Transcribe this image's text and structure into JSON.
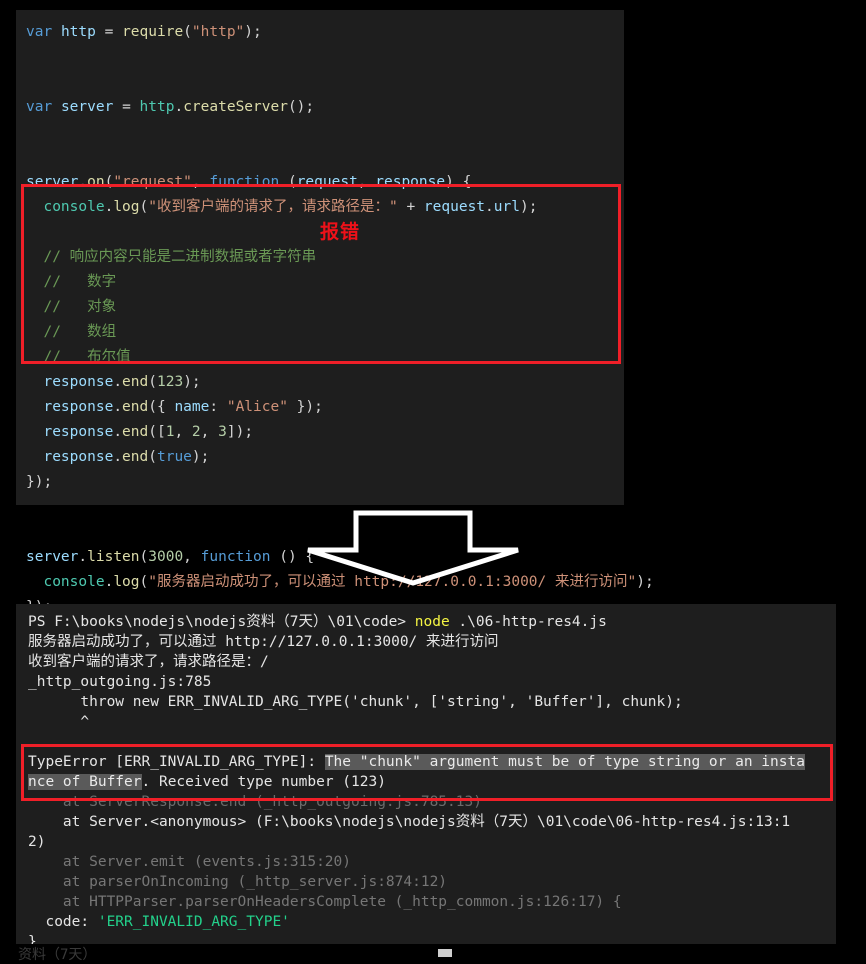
{
  "editor": {
    "name": "code-editor-panel",
    "background": "#1e1e1e",
    "lines": [
      {
        "id": "l1",
        "text": "var http = require(\"http\");"
      },
      {
        "id": "l2",
        "text": ""
      },
      {
        "id": "l3",
        "text": ""
      },
      {
        "id": "l4",
        "text": "var server = http.createServer();"
      },
      {
        "id": "l5",
        "text": ""
      },
      {
        "id": "l6",
        "text": ""
      },
      {
        "id": "l7",
        "text": "server.on(\"request\", function (request, response) {"
      },
      {
        "id": "l8",
        "text": "  console.log(\"收到客户端的请求了，请求路径是：\" + request.url);"
      },
      {
        "id": "l9",
        "text": ""
      },
      {
        "id": "l10",
        "text": "  // 响应内容只能是二进制数据或者字符串"
      },
      {
        "id": "l11",
        "text": "  //   数字"
      },
      {
        "id": "l12",
        "text": "  //   对象"
      },
      {
        "id": "l13",
        "text": "  //   数组"
      },
      {
        "id": "l14",
        "text": "  //   布尔值"
      },
      {
        "id": "l15",
        "text": "  response.end(123);"
      },
      {
        "id": "l16",
        "text": "  response.end({ name: \"Alice\" });"
      },
      {
        "id": "l17",
        "text": "  response.end([1, 2, 3]);"
      },
      {
        "id": "l18",
        "text": "  response.end(true);"
      },
      {
        "id": "l19",
        "text": "});"
      },
      {
        "id": "l20",
        "text": ""
      },
      {
        "id": "l21",
        "text": ""
      },
      {
        "id": "l22",
        "text": "server.listen(3000, function () {"
      },
      {
        "id": "l23",
        "text": "  console.log(\"服务器启动成功了，可以通过 http://127.0.0.1:3000/ 来进行访问\");"
      },
      {
        "id": "l24",
        "text": "});"
      }
    ]
  },
  "annotations": {
    "error_label": "报错",
    "error_label_color": "#ee1119",
    "box_color": "#f01f28",
    "arrow_name": "down-arrow",
    "arrow_color": "#ffffff"
  },
  "terminal": {
    "name": "powershell-terminal",
    "background": "#1e1e1e",
    "prompt_path": "PS F:\\books\\nodejs\\nodejs资料（7天）\\01\\code> ",
    "prompt_command": "node",
    "prompt_arg": " .\\06-http-res4.js",
    "lines": [
      {
        "id": "t2",
        "text": "服务器启动成功了，可以通过 http://127.0.0.1:3000/ 来进行访问"
      },
      {
        "id": "t3",
        "text": "收到客户端的请求了，请求路径是：/"
      },
      {
        "id": "t4",
        "text": "_http_outgoing.js:785"
      },
      {
        "id": "t5",
        "text": "      throw new ERR_INVALID_ARG_TYPE('chunk', ['string', 'Buffer'], chunk);"
      },
      {
        "id": "t6",
        "text": "      ^"
      }
    ],
    "error": {
      "prefix": "TypeError [ERR_INVALID_ARG_TYPE]: ",
      "selected_part1": "The \"chunk\" argument must be of type string or an insta",
      "selected_part2": "nce of Buffer",
      "suffix": ". Received type number (123)"
    },
    "stack": [
      {
        "id": "s1",
        "text": "    at ServerResponse.end (_http_outgoing.js:785:13)",
        "dim": "true"
      },
      {
        "id": "s2",
        "text": "    at Server.<anonymous> (F:\\books\\nodejs\\nodejs资料（7天）\\01\\code\\06-http-res4.js:13:1",
        "dim": "false"
      },
      {
        "id": "s3",
        "text": "2)",
        "dim": "false"
      },
      {
        "id": "s4",
        "text": "    at Server.emit (events.js:315:20)",
        "dim": "true"
      },
      {
        "id": "s5",
        "text": "    at parserOnIncoming (_http_server.js:874:12)",
        "dim": "true"
      },
      {
        "id": "s6",
        "text": "    at HTTPParser.parserOnHeadersComplete (_http_common.js:126:17) {",
        "dim": "true"
      }
    ],
    "code_key": "  code: ",
    "code_value": "'ERR_INVALID_ARG_TYPE'",
    "closing_brace": "}",
    "partial_bottom": "资料（7天）"
  }
}
